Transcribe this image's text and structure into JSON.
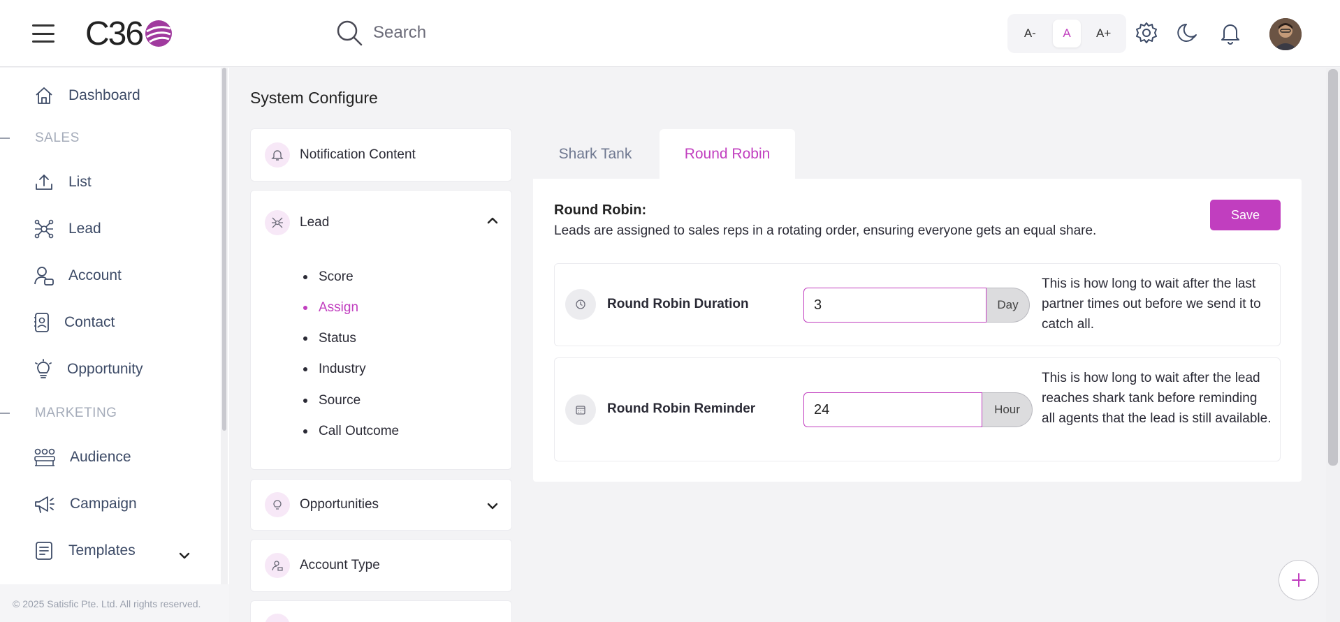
{
  "header": {
    "logo_text": "C36",
    "search_placeholder": "Search",
    "font_controls": [
      "A-",
      "A",
      "A+"
    ],
    "icons": [
      "menu-icon",
      "search-icon",
      "gear-icon",
      "moon-icon",
      "bell-icon"
    ],
    "accent_color": "#c13ebf"
  },
  "sidebar": {
    "dashboard": "Dashboard",
    "sales_heading": "SALES",
    "list": "List",
    "lead": "Lead",
    "account": "Account",
    "contact": "Contact",
    "opportunity": "Opportunity",
    "marketing_heading": "MARKETING",
    "audience": "Audience",
    "campaign": "Campaign",
    "templates": "Templates",
    "copyright": "© 2025 Satisfic Pte. Ltd. All rights reserved."
  },
  "page": {
    "title": "System Configure"
  },
  "config_menu": {
    "notification_content": "Notification Content",
    "lead": "Lead",
    "lead_items": [
      "Score",
      "Assign",
      "Status",
      "Industry",
      "Source",
      "Call Outcome"
    ],
    "active_item": "Assign",
    "opportunities": "Opportunities",
    "account_type": "Account Type"
  },
  "tabs": {
    "shark_tank": "Shark Tank",
    "round_robin": "Round Robin"
  },
  "round_robin": {
    "title": "Round Robin:",
    "description": "Leads are assigned to sales reps in a rotating order, ensuring everyone gets an equal share.",
    "save_label": "Save",
    "duration": {
      "label": "Round Robin Duration",
      "value": "3",
      "unit": "Day",
      "help": "This is how long to wait after the last partner times out before we send it to catch all."
    },
    "reminder": {
      "label": "Round Robin Reminder",
      "value": "24",
      "unit": "Hour",
      "help": "This is how long to wait after the lead reaches shark tank before reminding all agents that the lead is still available."
    }
  }
}
